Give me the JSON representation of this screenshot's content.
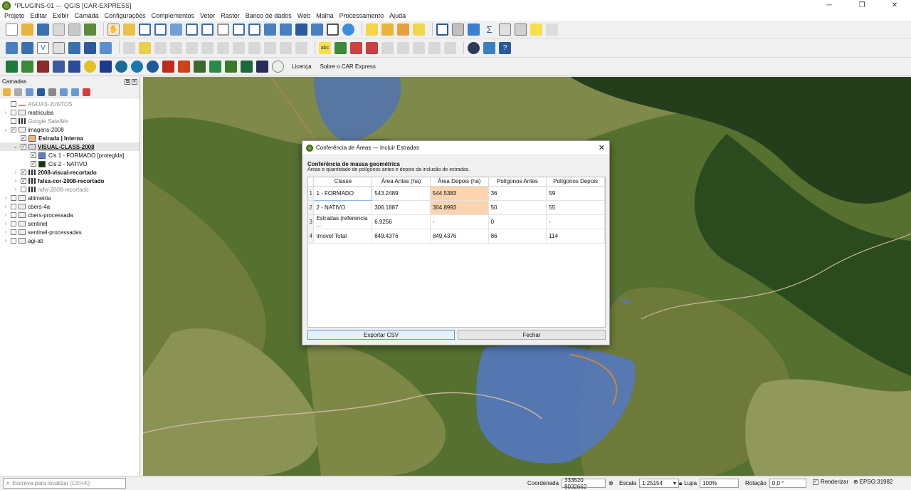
{
  "window": {
    "title": "*PLUGINS-01 — QGIS [CAR-EXPRESS]",
    "minimize": "─",
    "maximize": "❐",
    "close": "✕"
  },
  "menu": [
    "Projeto",
    "Editar",
    "Exibir",
    "Camada",
    "Configurações",
    "Complementos",
    "Vetor",
    "Raster",
    "Banco de dados",
    "Web",
    "Malha",
    "Processamento",
    "Ajuda"
  ],
  "toolbar3": {
    "license_label": "Licença",
    "about_label": "Sobre o CAR Express"
  },
  "layers_panel": {
    "title": "Camadas",
    "layers": [
      {
        "name": "AGUAS-JUNTOS",
        "level": 0,
        "expander": "",
        "checked": false,
        "style": "italic",
        "icon": "line-layer-icon"
      },
      {
        "name": "matriculas",
        "level": 0,
        "expander": "›",
        "checked": false,
        "style": "",
        "icon": "group-icon"
      },
      {
        "name": "Google Satellite",
        "level": 0,
        "expander": "",
        "checked": false,
        "style": "italic",
        "icon": "raster-layer-icon"
      },
      {
        "name": "imagens-2008",
        "level": 0,
        "expander": "⌄",
        "checked": true,
        "style": "",
        "icon": "group-icon"
      },
      {
        "name": "Estrada | Interna",
        "level": 1,
        "expander": "",
        "checked": true,
        "style": "bold",
        "icon": "swatch",
        "color": "#f3b27a"
      },
      {
        "name": "VISUAL-CLASS-2008",
        "level": 1,
        "expander": "⌄",
        "checked": true,
        "style": "bold underline",
        "icon": "polygon-layer-icon",
        "selected": true
      },
      {
        "name": "Cls 1 - FORMADO [protegida]",
        "level": 2,
        "expander": "",
        "checked": true,
        "style": "",
        "icon": "swatch",
        "color": "#5b7fd6"
      },
      {
        "name": "Cls 2 - NATIVO",
        "level": 2,
        "expander": "",
        "checked": true,
        "style": "",
        "icon": "swatch",
        "color": "#0f3d12"
      },
      {
        "name": "2008-visual-recortado",
        "level": 1,
        "expander": "›",
        "checked": true,
        "style": "bold",
        "icon": "raster-layer-icon"
      },
      {
        "name": "falsa-cor-2008-recortado",
        "level": 1,
        "expander": "›",
        "checked": true,
        "style": "bold",
        "icon": "raster-layer-icon"
      },
      {
        "name": "ndvi-2008-recortado",
        "level": 1,
        "expander": "›",
        "checked": false,
        "style": "italic",
        "icon": "raster-layer-icon"
      },
      {
        "name": "altimetria",
        "level": 0,
        "expander": "›",
        "checked": false,
        "style": "",
        "icon": "group-icon"
      },
      {
        "name": "cbers-4a",
        "level": 0,
        "expander": "›",
        "checked": false,
        "style": "",
        "icon": "group-icon"
      },
      {
        "name": "cbers-processada",
        "level": 0,
        "expander": "›",
        "checked": false,
        "style": "",
        "icon": "group-icon"
      },
      {
        "name": "sentinel",
        "level": 0,
        "expander": "›",
        "checked": false,
        "style": "",
        "icon": "group-icon"
      },
      {
        "name": "sentinel-processadas",
        "level": 0,
        "expander": "›",
        "checked": false,
        "style": "",
        "icon": "group-icon"
      },
      {
        "name": "agi-ati",
        "level": 0,
        "expander": "›",
        "checked": false,
        "style": "",
        "icon": "group-icon"
      }
    ]
  },
  "dialog": {
    "title": "Conferência de Áreas — Incluir Estradas",
    "close": "✕",
    "heading": "Conferência de massa geométrica",
    "subheading": "Áreas e quantidade de polígonos antes e depois da inclusão de estradas.",
    "columns": [
      "Classe",
      "Área Antes (ha)",
      "Área Depois (ha)",
      "Polígonos Antes",
      "Polígonos Depois"
    ],
    "rows": [
      {
        "n": "1",
        "cells": [
          "1 - FORMADO",
          "543.2489",
          "544.5383",
          "36",
          "59"
        ],
        "highlight": 2
      },
      {
        "n": "2",
        "cells": [
          "2 - NATIVO",
          "306.1887",
          "304.8993",
          "50",
          "55"
        ],
        "highlight": 2
      },
      {
        "n": "3",
        "cells": [
          "Estradas (referencia ...",
          "6.9256",
          "-",
          "0",
          "-"
        ],
        "highlight": -1
      },
      {
        "n": "4",
        "cells": [
          "Imovel Total",
          "849.4376",
          "849.4376",
          "86",
          "114"
        ],
        "highlight": -1
      }
    ],
    "export_label": "Exportar CSV",
    "close_label": "Fechar"
  },
  "statusbar": {
    "locator_placeholder": "Escreva para localizar (Ctrl+K)",
    "coord_label": "Coordenada",
    "coord_value": "333520  8032662",
    "scale_label": "Escala",
    "scale_value": "1:25154",
    "magnifier_label": "Lupa",
    "magnifier_value": "100%",
    "rotation_label": "Rotação",
    "rotation_value": "0,0 °",
    "render_label": "Renderizar",
    "crs_label": "EPSG:31982"
  },
  "colors": {
    "accent": "#5a9ad8",
    "highlight_cell": "#fcd5b0",
    "qgis_green": "#6b9e2e"
  }
}
